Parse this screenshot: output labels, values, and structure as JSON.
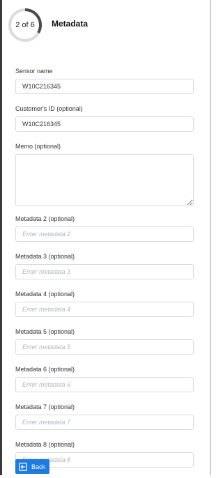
{
  "header": {
    "progress_text": "2 of 6",
    "progress_fraction": 0.333,
    "title": "Metadata"
  },
  "fields": {
    "sensor_name": {
      "label": "Sensor name",
      "value": "W10C216345"
    },
    "customer_id": {
      "label": "Customer's ID (optional)",
      "value": "W10C216345"
    },
    "memo": {
      "label": "Memo (optional)",
      "value": ""
    },
    "metadata_2": {
      "label": "Metadata 2 (optional)",
      "placeholder": "Enter metadata 2"
    },
    "metadata_3": {
      "label": "Metadata 3 (optional)",
      "placeholder": "Enter metadata 3"
    },
    "metadata_4": {
      "label": "Metadata 4 (optional)",
      "placeholder": "Enter metadata 4"
    },
    "metadata_5": {
      "label": "Metadata 5 (optional)",
      "placeholder": "Enter metadata 5"
    },
    "metadata_6": {
      "label": "Metadata 6 (optional)",
      "placeholder": "Enter metadata 6"
    },
    "metadata_7": {
      "label": "Metadata 7 (optional)",
      "placeholder": "Enter metadata 7"
    },
    "metadata_8": {
      "label": "Metadata 8 (optional)",
      "placeholder": "Enter metadata 8"
    }
  },
  "footer": {
    "back_label": "Back",
    "back_icon": "back-arrow-icon"
  },
  "colors": {
    "accent": "#1e7ce0",
    "ring_progress": "#4a4a4a",
    "ring_track": "#dcdcdc"
  }
}
